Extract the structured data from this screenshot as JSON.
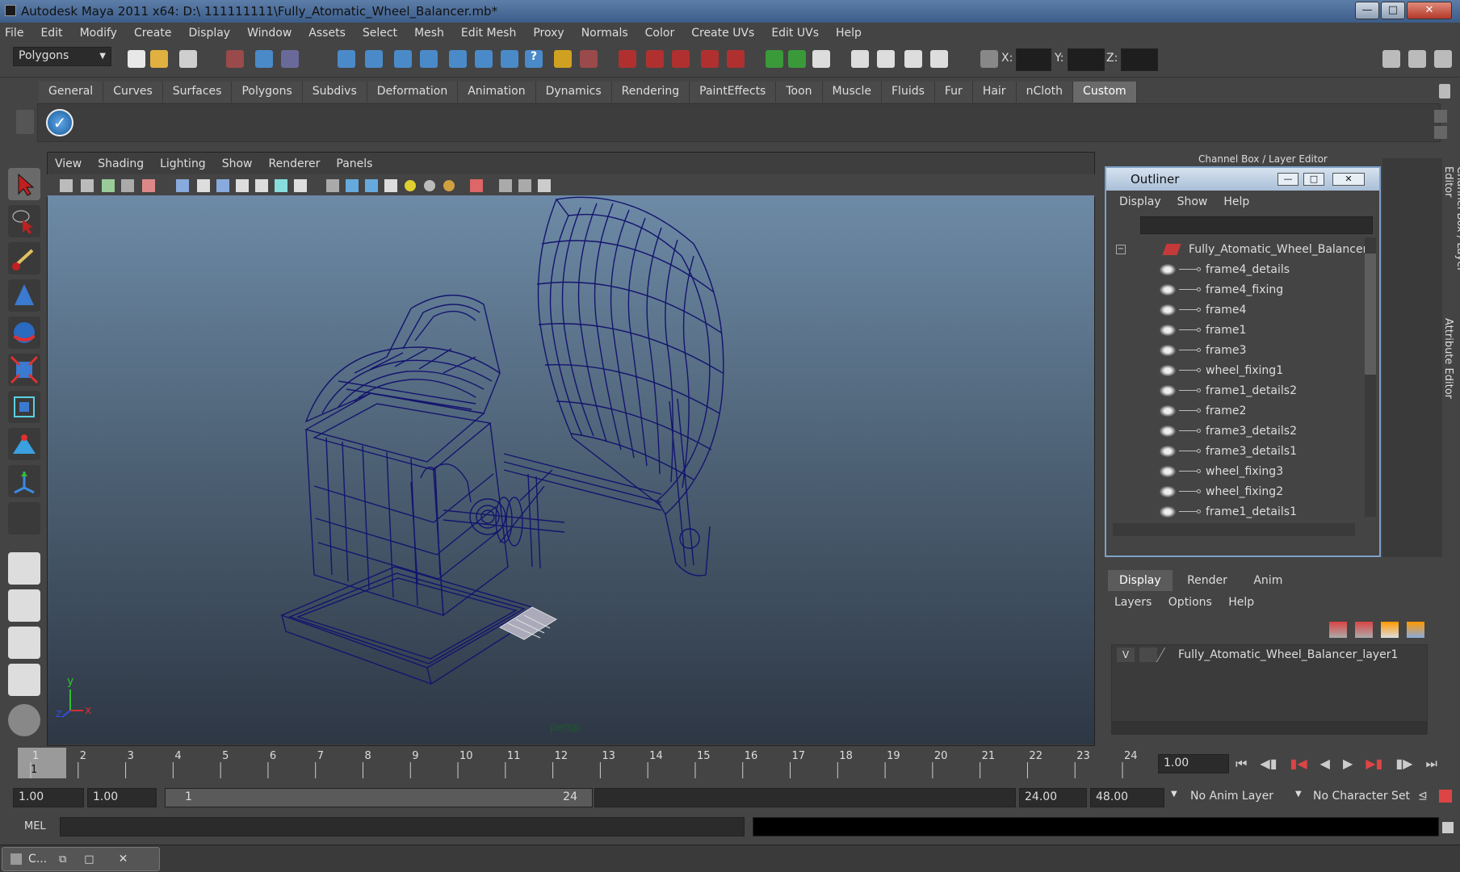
{
  "window": {
    "title": "Autodesk Maya 2011 x64: D:\\ 111111111\\Fully_Atomatic_Wheel_Balancer.mb*"
  },
  "menubar": [
    "File",
    "Edit",
    "Modify",
    "Create",
    "Display",
    "Window",
    "Assets",
    "Select",
    "Mesh",
    "Edit Mesh",
    "Proxy",
    "Normals",
    "Color",
    "Create UVs",
    "Edit UVs",
    "Help"
  ],
  "status": {
    "mode": "Polygons",
    "x_label": "X:",
    "y_label": "Y:",
    "z_label": "Z:"
  },
  "shelf_tabs": [
    "General",
    "Curves",
    "Surfaces",
    "Polygons",
    "Subdivs",
    "Deformation",
    "Animation",
    "Dynamics",
    "Rendering",
    "PaintEffects",
    "Toon",
    "Muscle",
    "Fluids",
    "Fur",
    "Hair",
    "nCloth",
    "Custom"
  ],
  "shelf_active": "Custom",
  "viewport": {
    "menu": [
      "View",
      "Shading",
      "Lighting",
      "Show",
      "Renderer",
      "Panels"
    ],
    "camera_label": "persp",
    "axis_y": "y",
    "axis_x": "x",
    "axis_z": "z"
  },
  "outliner": {
    "title": "Outliner",
    "menu": [
      "Display",
      "Show",
      "Help"
    ],
    "root": "Fully_Atomatic_Wheel_Balancer",
    "items": [
      "frame4_details",
      "frame4_fixing",
      "frame4",
      "frame1",
      "frame3",
      "wheel_fixing1",
      "frame1_details2",
      "frame2",
      "frame3_details2",
      "frame3_details1",
      "wheel_fixing3",
      "wheel_fixing2",
      "frame1_details1"
    ]
  },
  "channel_box": {
    "title": "Channel Box / Layer Editor",
    "side_tab_1": "Channel Box / Layer Editor",
    "side_tab_2": "Attribute Editor"
  },
  "layers": {
    "tabs": [
      "Display",
      "Render",
      "Anim"
    ],
    "menu": [
      "Layers",
      "Options",
      "Help"
    ],
    "layer_visible": "V",
    "layer_name": "Fully_Atomatic_Wheel_Balancer_layer1"
  },
  "timeline": {
    "ticks": [
      "1",
      "2",
      "3",
      "4",
      "5",
      "6",
      "7",
      "8",
      "9",
      "10",
      "11",
      "12",
      "13",
      "14",
      "15",
      "16",
      "17",
      "18",
      "19",
      "20",
      "21",
      "22",
      "23",
      "24"
    ],
    "current_frame": "1",
    "current_time": "1.00"
  },
  "range": {
    "start": "1.00",
    "playback_start": "1.00",
    "slider_start": "1",
    "slider_end": "24",
    "playback_end": "24.00",
    "end": "48.00",
    "anim_layer": "No Anim Layer",
    "char_set": "No Character Set"
  },
  "cmdline": {
    "label": "MEL"
  },
  "taskbar": {
    "item": "C..."
  },
  "colors": {
    "wire": "#14146e",
    "accent": "#7ea1c8"
  }
}
